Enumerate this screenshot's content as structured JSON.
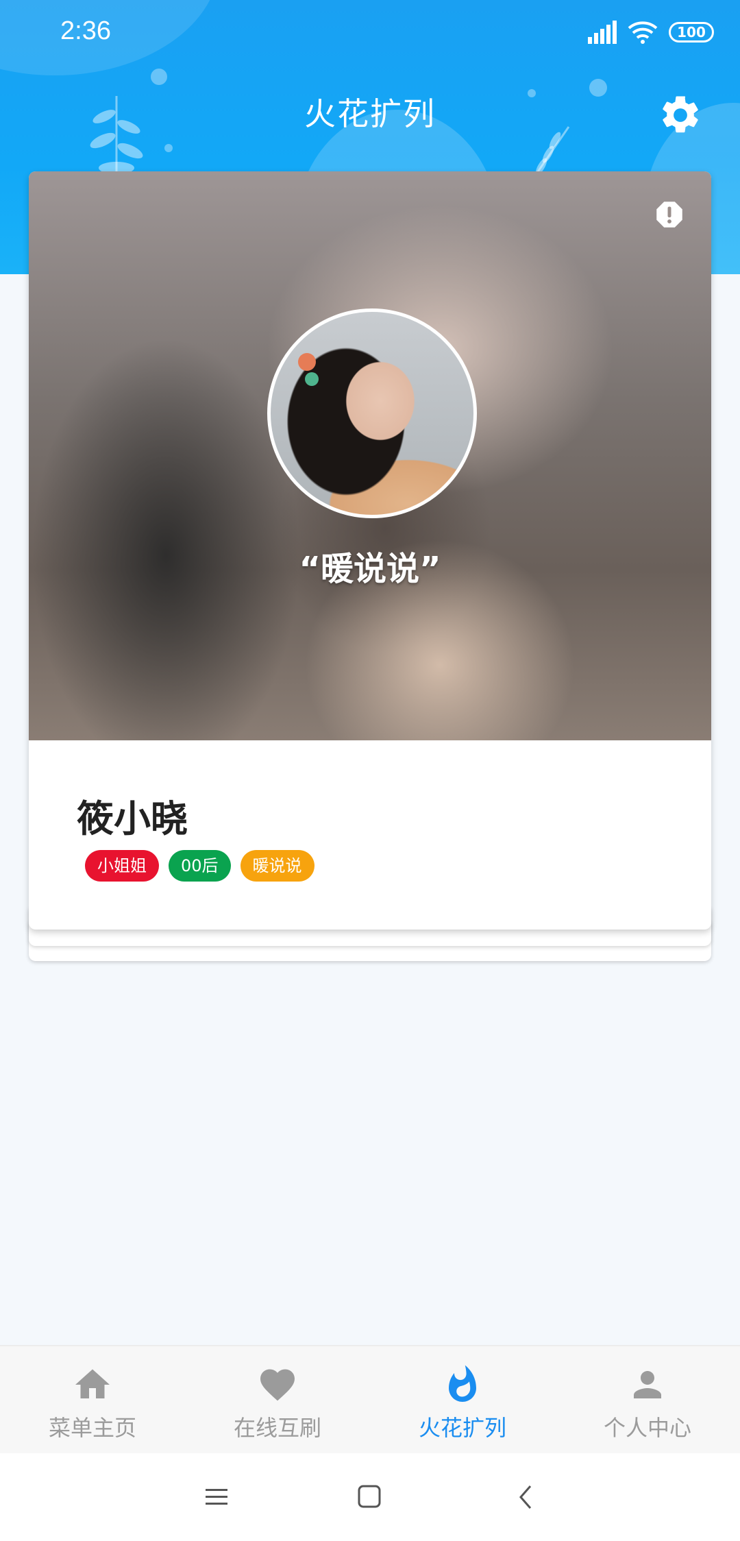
{
  "status_bar": {
    "time": "2:36",
    "battery": "100"
  },
  "header": {
    "title": "火花扩列"
  },
  "profile_card": {
    "quote": "“暖说说”",
    "name": "筱小晓",
    "tags": [
      {
        "label": "小姐姐",
        "color": "#e8132f"
      },
      {
        "label": "00后",
        "color": "#0aa34f"
      },
      {
        "label": "暖说说",
        "color": "#f7a30e"
      }
    ]
  },
  "bottom_nav": {
    "items": [
      {
        "label": "菜单主页",
        "icon": "home-icon",
        "active": false
      },
      {
        "label": "在线互刷",
        "icon": "heart-icon",
        "active": false
      },
      {
        "label": "火花扩列",
        "icon": "flame-icon",
        "active": true
      },
      {
        "label": "个人中心",
        "icon": "person-icon",
        "active": false
      }
    ]
  },
  "colors": {
    "header_blue": "#1aa0f2",
    "accent": "#1a8df0",
    "inactive": "#9b9b9b"
  }
}
